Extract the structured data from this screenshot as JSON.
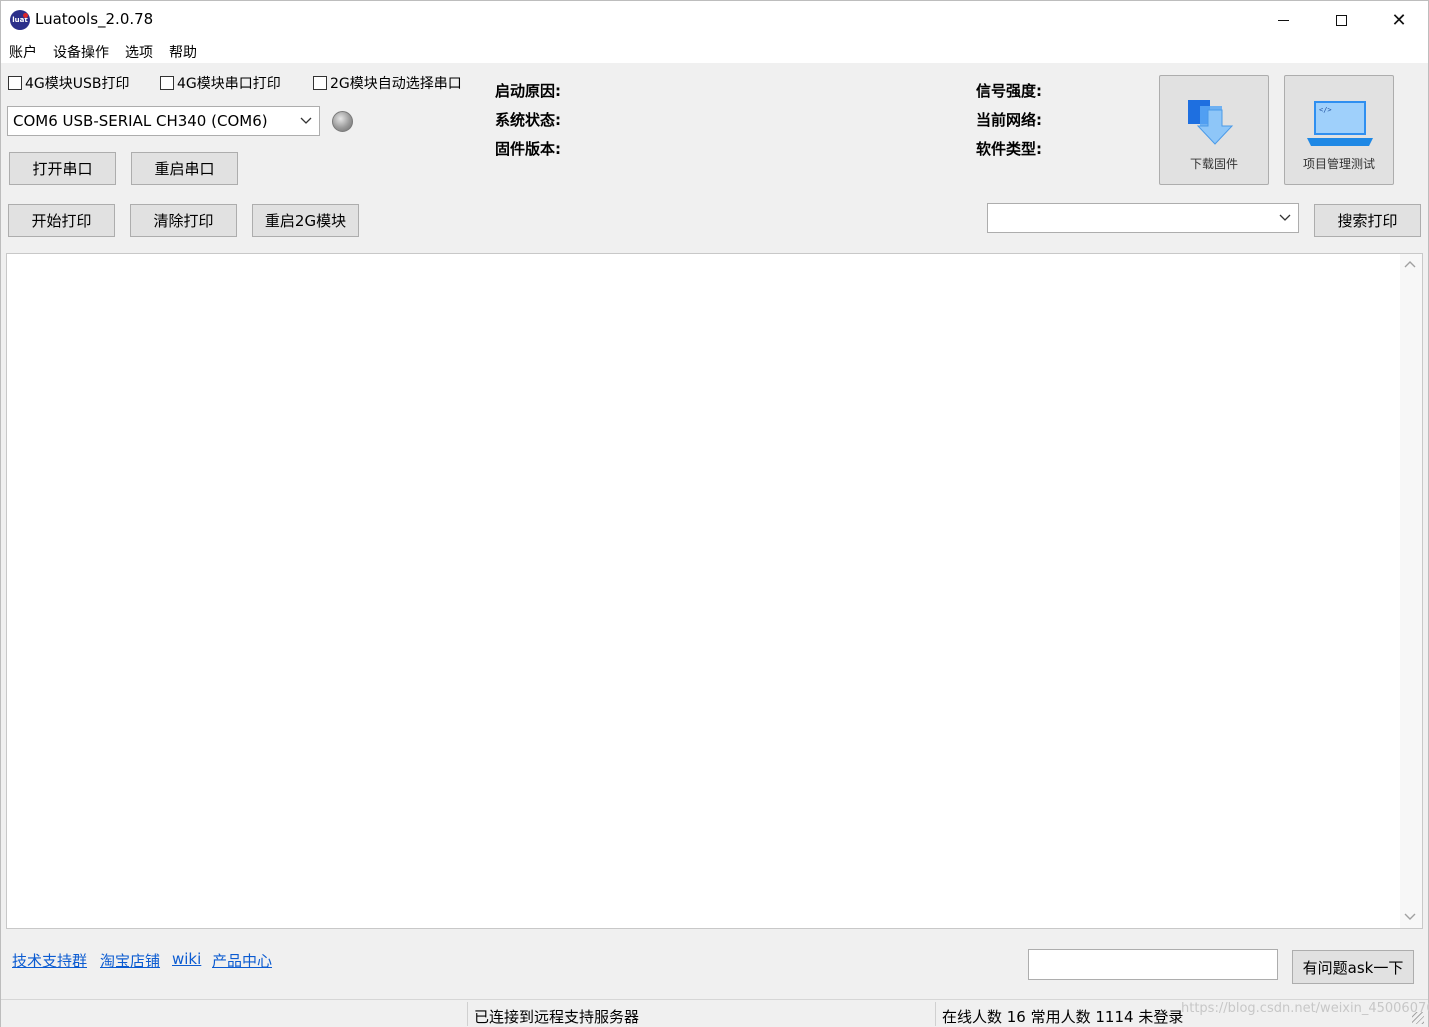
{
  "window": {
    "title": "Luatools_2.0.78",
    "logo_text": "luat"
  },
  "menu": [
    "账户",
    "设备操作",
    "选项",
    "帮助"
  ],
  "checkboxes": [
    {
      "label": "4G模块USB打印",
      "checked": false
    },
    {
      "label": "4G模块串口打印",
      "checked": false
    },
    {
      "label": "2G模块自动选择串口",
      "checked": false
    }
  ],
  "port_select": {
    "value": "COM6 USB-SERIAL CH340 (COM6)"
  },
  "buttons": {
    "open_port": "打开串口",
    "restart_port": "重启串口",
    "start_print": "开始打印",
    "clear_print": "清除打印",
    "restart_2g": "重启2G模块",
    "search_print": "搜索打印",
    "ask": "有问题ask一下"
  },
  "info": {
    "boot_reason": "启动原因:",
    "system_status": "系统状态:",
    "firmware_version": "固件版本:",
    "signal_strength": "信号强度:",
    "current_network": "当前网络:",
    "software_type": "软件类型:"
  },
  "big_buttons": {
    "download": "下载固件",
    "project": "项目管理测试"
  },
  "search_select": {
    "value": ""
  },
  "links": [
    "技术支持群",
    "淘宝店铺",
    "wiki",
    "产品中心"
  ],
  "ask_input": {
    "value": ""
  },
  "status": {
    "server": "已连接到远程支持服务器",
    "online": "在线人数 16 常用人数 1114 未登录"
  },
  "watermark": "https://blog.csdn.net/weixin_45006076",
  "colors": {
    "accent_blue": "#2f8ff0",
    "link": "#0b5bd1"
  }
}
